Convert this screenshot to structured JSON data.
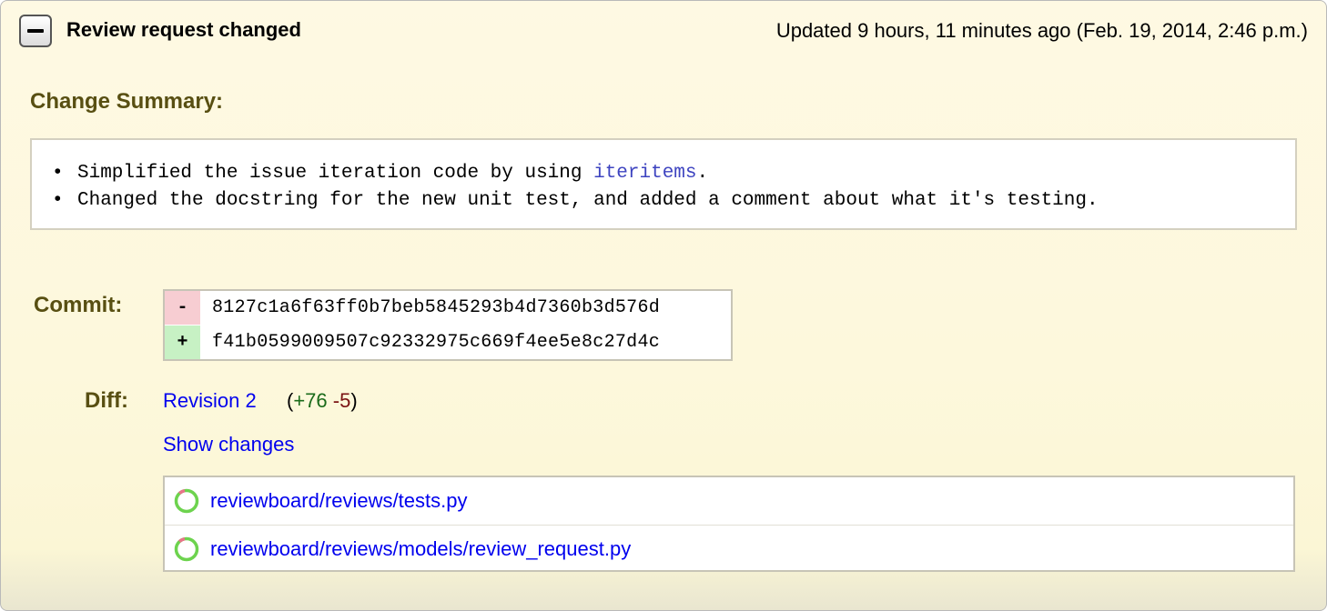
{
  "header": {
    "title": "Review request changed",
    "timestamp": "Updated 9 hours, 11 minutes ago (Feb. 19, 2014, 2:46 p.m.)",
    "collapse_icon": "minus-icon"
  },
  "change_summary": {
    "heading": "Change Summary:",
    "items": [
      {
        "prefix": "Simplified the issue iteration code by using ",
        "code": "iteritems",
        "suffix": "."
      },
      {
        "text": "Changed the docstring for the new unit test, and added a comment about what it's testing."
      }
    ]
  },
  "commit": {
    "label": "Commit:",
    "old": {
      "sign": "-",
      "hash": "8127c1a6f63ff0b7beb5845293b4d7360b3d576d"
    },
    "new": {
      "sign": "+",
      "hash": "f41b0599009507c92332975c669f4ee5e8c27d4c"
    }
  },
  "diff": {
    "label": "Diff:",
    "revision": "Revision 2",
    "stats_open": "(",
    "insertions": "+76",
    "deletions": "-5",
    "stats_close": ")",
    "show_changes": "Show changes",
    "files": [
      {
        "path": "reviewboard/reviews/tests.py",
        "icon": "diff-ratio-icon"
      },
      {
        "path": "reviewboard/reviews/models/review_request.py",
        "icon": "diff-ratio-icon"
      }
    ]
  },
  "colors": {
    "heading": "#584f12",
    "link": "#0000ee",
    "code_link": "#3e44c0",
    "insert": "#1a6b1a",
    "delete": "#7a1212",
    "old_bg": "#f7cdd2",
    "new_bg": "#c7f1c4",
    "icon_green": "#6dd34e",
    "icon_red": "#e8748a"
  }
}
